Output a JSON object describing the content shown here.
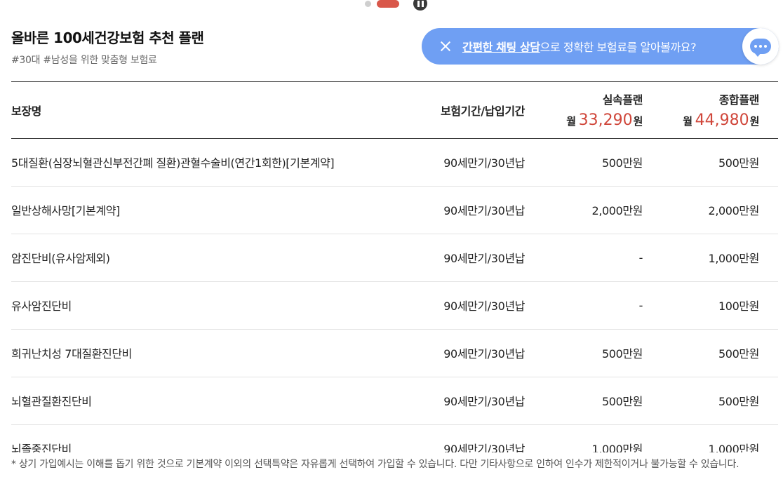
{
  "header": {
    "title": "올바른 100세건강보험 추천 플랜",
    "subtitle": "#30대 #남성을 위한 맞춤형 보험료"
  },
  "chat_banner": {
    "link_text": "간편한 채팅 상담",
    "rest_text": "으로 정확한 보험료를 알아볼까요?"
  },
  "table": {
    "columns": {
      "coverage": "보장명",
      "period": "보험기간/납입기간"
    },
    "plans": [
      {
        "name": "실속플랜",
        "price_prefix": "월",
        "price": "33,290",
        "price_suffix": "원"
      },
      {
        "name": "종합플랜",
        "price_prefix": "월",
        "price": "44,980",
        "price_suffix": "원"
      }
    ],
    "rows": [
      {
        "coverage": "5대질환(심장뇌혈관신부전간폐 질환)관혈수술비(연간1회한)[기본계약]",
        "period": "90세만기/30년납",
        "basic": "500만원",
        "comprehensive": "500만원"
      },
      {
        "coverage": "일반상해사망[기본계약]",
        "period": "90세만기/30년납",
        "basic": "2,000만원",
        "comprehensive": "2,000만원"
      },
      {
        "coverage": "암진단비(유사암제외)",
        "period": "90세만기/30년납",
        "basic": "-",
        "comprehensive": "1,000만원"
      },
      {
        "coverage": "유사암진단비",
        "period": "90세만기/30년납",
        "basic": "-",
        "comprehensive": "100만원"
      },
      {
        "coverage": "희귀난치성 7대질환진단비",
        "period": "90세만기/30년납",
        "basic": "500만원",
        "comprehensive": "500만원"
      },
      {
        "coverage": "뇌혈관질환진단비",
        "period": "90세만기/30년납",
        "basic": "500만원",
        "comprehensive": "500만원"
      },
      {
        "coverage": "뇌졸중진단비",
        "period": "90세만기/30년납",
        "basic": "1,000만원",
        "comprehensive": "1,000만원"
      }
    ]
  },
  "footnote": "* 상기 가입예시는 이해를 돕기 위한 것으로 기본계약 이외의 선택특약은 자유롭게 선택하여 가입할 수 있습니다. 다만 기타사항으로 인하여 인수가 제한적이거나 불가능할 수 있습니다.",
  "icons": {
    "close": "close-icon",
    "chat": "chat-bubble-icon",
    "pause": "pause-icon"
  },
  "colors": {
    "accent_price": "#d0473b",
    "banner_bg": "#6f9ff3",
    "carousel_active": "#d9574a"
  }
}
